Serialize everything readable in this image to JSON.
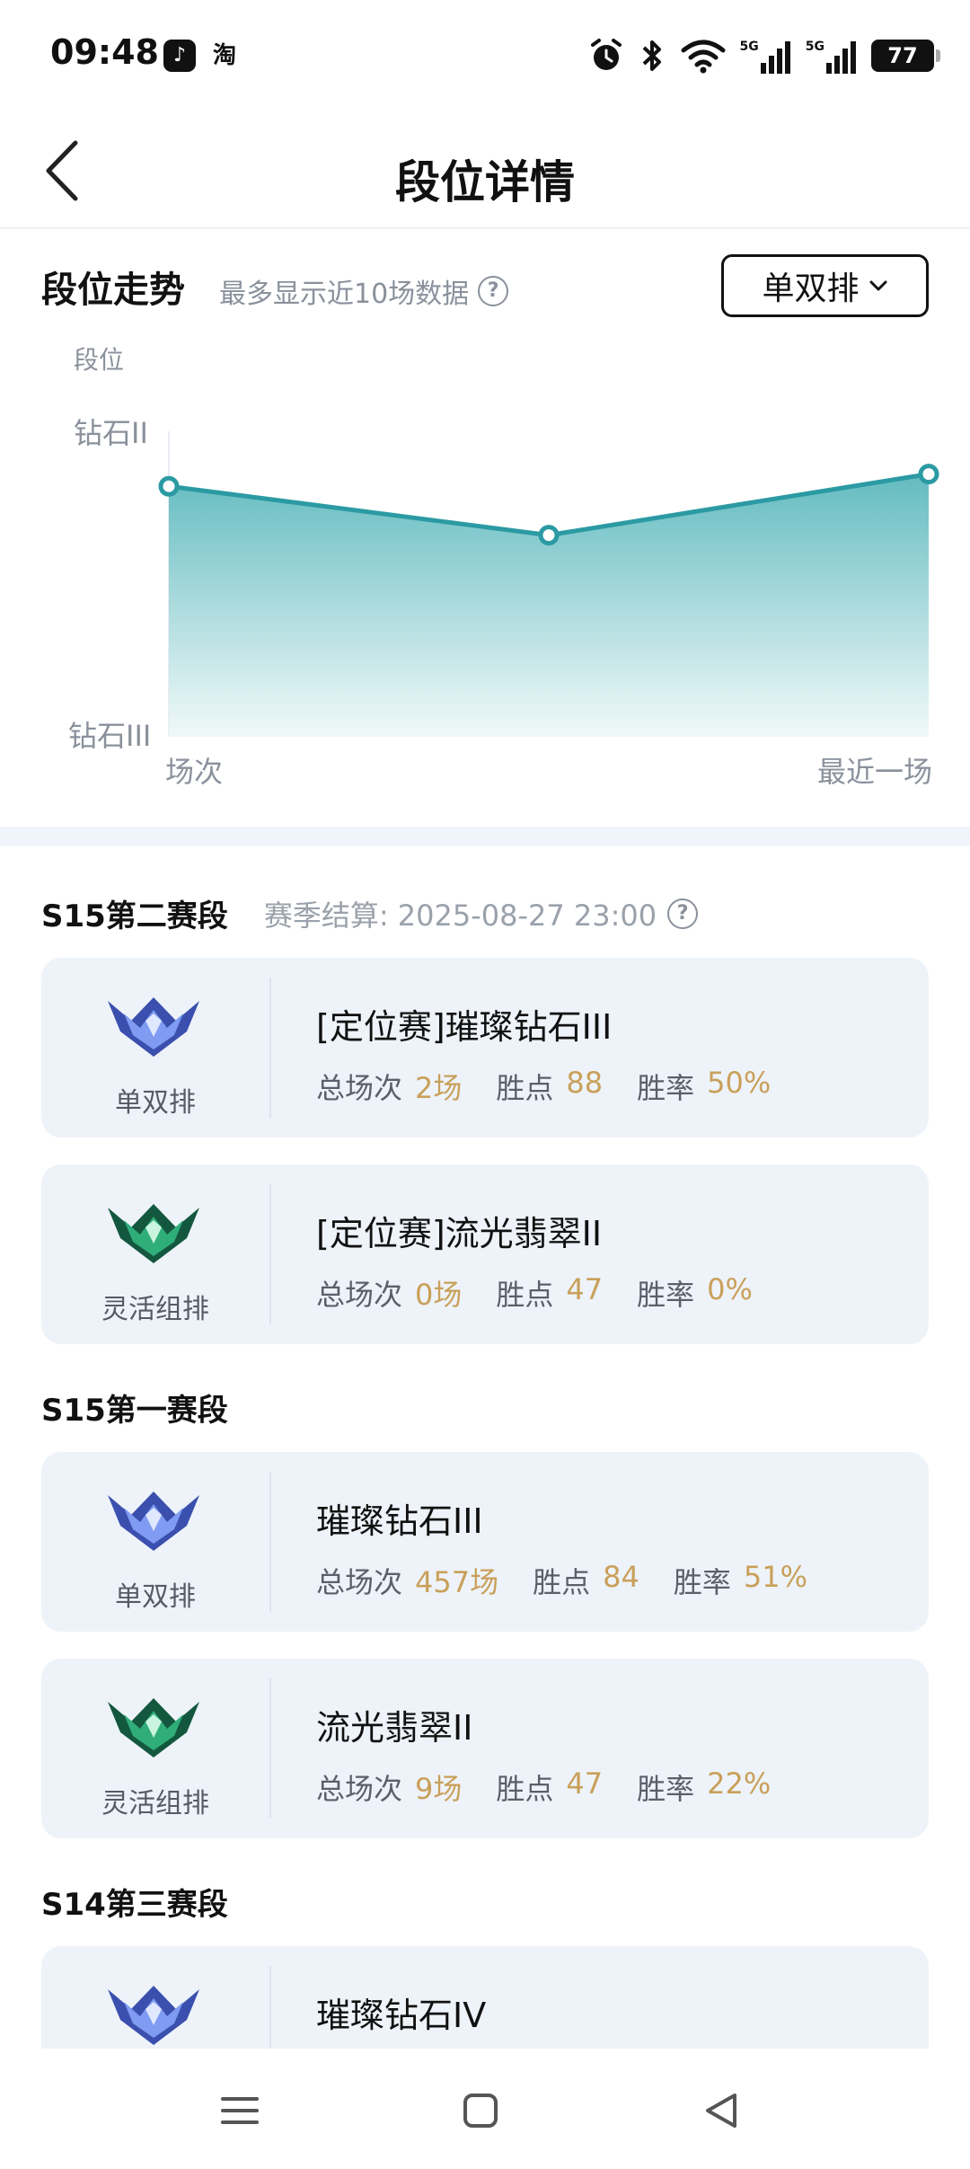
{
  "status_bar": {
    "time": "09:48",
    "apps": [
      {
        "name": "tiktok-icon",
        "glyph": "♪"
      },
      {
        "name": "taobao-icon",
        "glyph": "淘"
      }
    ],
    "network_label_1": "5G",
    "network_label_2": "5G",
    "battery": "77"
  },
  "header": {
    "title": "段位详情",
    "back_icon": "chevron-left-icon"
  },
  "trend": {
    "title": "段位走势",
    "subtitle": "最多显示近10场数据",
    "help_glyph": "?",
    "queue_selector": "单双排",
    "dropdown_icon": "chevron-down-icon"
  },
  "chart_data": {
    "type": "area",
    "ylabel": "段位",
    "y_ticks": [
      "钻石II",
      "钻石III"
    ],
    "x_labels": [
      "场次",
      "最近一场"
    ],
    "series": [
      {
        "values": [
          0.82,
          0.66,
          0.86
        ]
      }
    ],
    "ylim": [
      0,
      1
    ],
    "colors": {
      "line": "#2b9aa3",
      "fill_top": "#5bb8bd",
      "fill_bottom": "#eef8f8"
    }
  },
  "seasons": [
    {
      "name": "S15第二赛段",
      "note": "赛季结算: 2025-08-27 23:00",
      "cards": [
        {
          "queue": "单双排",
          "rank": "[定位赛]璀璨钻石III",
          "games_label": "总场次",
          "games": "2场",
          "points_label": "胜点",
          "points": "88",
          "winrate_label": "胜率",
          "winrate": "50%",
          "tier": "diamond"
        },
        {
          "queue": "灵活组排",
          "rank": "[定位赛]流光翡翠II",
          "games_label": "总场次",
          "games": "0场",
          "points_label": "胜点",
          "points": "47",
          "winrate_label": "胜率",
          "winrate": "0%",
          "tier": "emerald"
        }
      ]
    },
    {
      "name": "S15第一赛段",
      "cards": [
        {
          "queue": "单双排",
          "rank": "璀璨钻石III",
          "games_label": "总场次",
          "games": "457场",
          "points_label": "胜点",
          "points": "84",
          "winrate_label": "胜率",
          "winrate": "51%",
          "tier": "diamond"
        },
        {
          "queue": "灵活组排",
          "rank": "流光翡翠II",
          "games_label": "总场次",
          "games": "9场",
          "points_label": "胜点",
          "points": "47",
          "winrate_label": "胜率",
          "winrate": "22%",
          "tier": "emerald"
        }
      ]
    },
    {
      "name": "S14第三赛段",
      "cards": [
        {
          "queue": "",
          "rank": "璀璨钻石IV",
          "tier": "diamond"
        }
      ]
    }
  ],
  "nav_bar": {
    "items": [
      "menu-icon",
      "home-icon",
      "back-icon"
    ]
  },
  "colors": {
    "accent_gold": "#c9a05a",
    "chart_teal": "#2b9aa3",
    "card_bg": "#eef3f9"
  }
}
